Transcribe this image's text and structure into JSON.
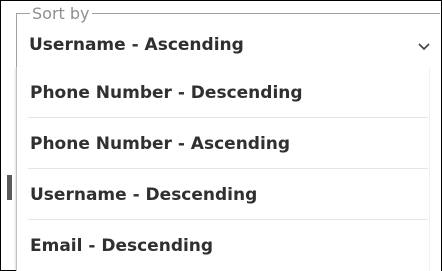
{
  "sort": {
    "legend": "Sort by",
    "selected": "Username - Ascending",
    "chevron_icon": "chevron-down-icon",
    "options": [
      {
        "label": "Phone Number - Descending"
      },
      {
        "label": "Phone Number - Ascending"
      },
      {
        "label": "Username - Descending"
      },
      {
        "label": "Email - Descending"
      }
    ]
  },
  "colors": {
    "text": "#303030",
    "legend": "#8f8f8f",
    "border": "#000000"
  }
}
